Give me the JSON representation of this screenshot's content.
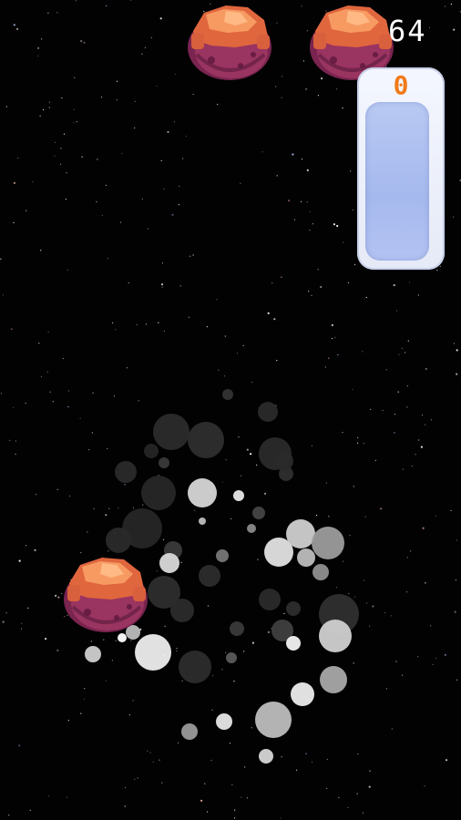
{
  "hud": {
    "score": "64",
    "counter": "0"
  },
  "colors": {
    "background": "#020203",
    "asteroid_top": "#f0794a",
    "asteroid_body": "#8a2c54",
    "counter_text": "#f07a1a",
    "panel_fill": "#a6b9ee"
  },
  "sprites": {
    "asteroid_icon": "asteroid",
    "explosion": "explosion-particles"
  }
}
